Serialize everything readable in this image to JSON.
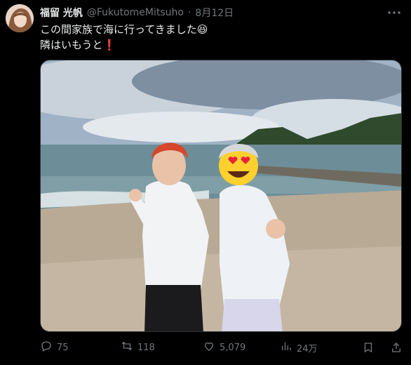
{
  "tweet": {
    "author_name": "福留 光帆",
    "handle": "@FukutomeMitsuho",
    "separator": "·",
    "date": "8月12日",
    "text_line1": "この間家族で海に行ってきました😆",
    "text_line2": "隣はいもうと❗"
  },
  "actions": {
    "replies": "75",
    "retweets": "118",
    "likes": "5,079",
    "views": "24万"
  },
  "icons": [
    "more-icon",
    "reply-icon",
    "retweet-icon",
    "like-icon",
    "views-icon",
    "bookmark-icon",
    "share-icon"
  ]
}
